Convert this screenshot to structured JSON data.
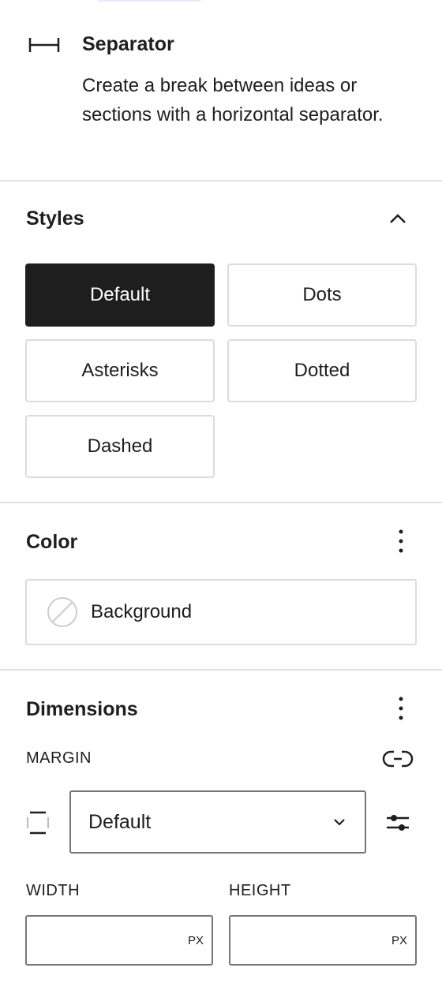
{
  "block": {
    "title": "Separator",
    "description": "Create a break between ideas or sections with a horizontal separator.",
    "icon": "separator-icon"
  },
  "styles": {
    "title": "Styles",
    "options": [
      "Default",
      "Dots",
      "Asterisks",
      "Dotted",
      "Dashed"
    ],
    "selected": "Default"
  },
  "color": {
    "title": "Color",
    "background_label": "Background"
  },
  "dimensions": {
    "title": "Dimensions",
    "margin_label": "MARGIN",
    "margin_value": "Default",
    "width_label": "WIDTH",
    "height_label": "HEIGHT",
    "width_unit": "PX",
    "height_unit": "PX"
  },
  "colors": {
    "text": "#1e1e1e",
    "border": "#dcdcdc",
    "divider": "#e0e0e0",
    "selected_bg": "#1e1e1e"
  }
}
